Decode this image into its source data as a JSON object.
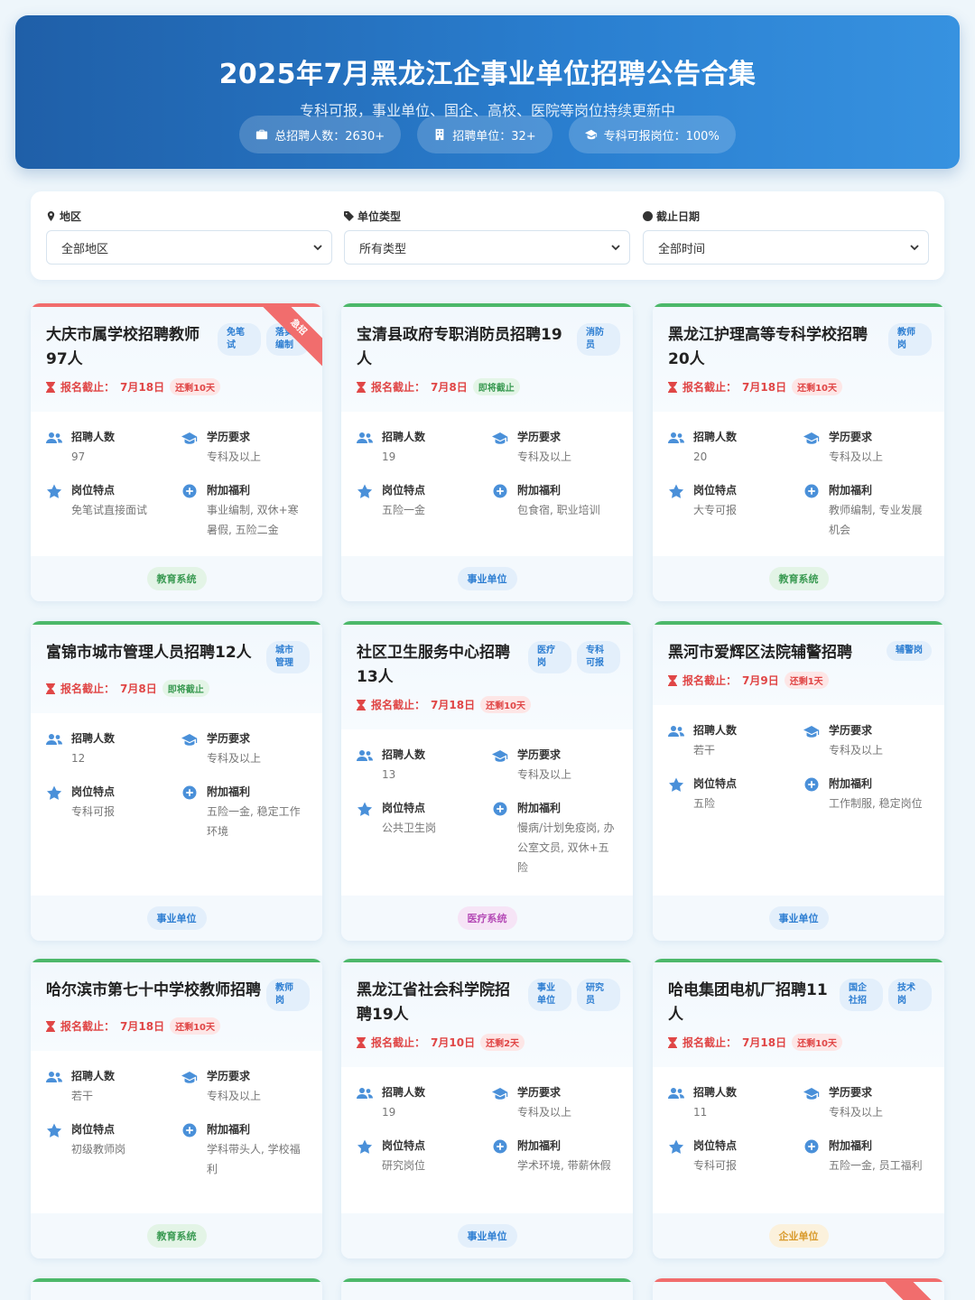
{
  "hero": {
    "title": "2025年7月黑龙江企事业单位招聘公告合集",
    "subtitle": "专科可报，事业单位、国企、高校、医院等岗位持续更新中",
    "stats": [
      "总招聘人数：2630+",
      "招聘单位：32+",
      "专科可报岗位：100%"
    ]
  },
  "filters": [
    {
      "label": "地区",
      "value": "全部地区",
      "icon": "map-marker-icon"
    },
    {
      "label": "单位类型",
      "value": "所有类型",
      "icon": "tag-icon"
    },
    {
      "label": "截止日期",
      "value": "全部时间",
      "icon": "clock-icon"
    }
  ],
  "labels": {
    "deadline_prefix": "报名截止：",
    "count": "招聘人数",
    "edu": "学历要求",
    "feature": "岗位特点",
    "benefit": "附加福利"
  },
  "urgent_ribbon": "急招",
  "cards": [
    {
      "title": "大庆市属学校招聘教师97人",
      "tags": [
        "免笔试",
        "落实编制"
      ],
      "deadline": "7月18日",
      "remain": "还剩10天",
      "count": "97",
      "edu": "专科及以上",
      "feature": "免笔试直接面试",
      "benefit": "事业编制, 双休+寒暑假, 五险二金",
      "category": "教育系统"
    },
    {
      "title": "宝清县政府专职消防员招聘19人",
      "tags": [
        "消防员"
      ],
      "deadline": "7月8日",
      "remain": "即将截止",
      "count": "19",
      "edu": "专科及以上",
      "feature": "五险一金",
      "benefit": "包食宿, 职业培训",
      "category": "事业单位"
    },
    {
      "title": "黑龙江护理高等专科学校招聘20人",
      "tags": [
        "教师岗"
      ],
      "deadline": "7月18日",
      "remain": "还剩10天",
      "count": "20",
      "edu": "专科及以上",
      "feature": "大专可报",
      "benefit": "教师编制, 专业发展机会",
      "category": "教育系统"
    },
    {
      "title": "富锦市城市管理人员招聘12人",
      "tags": [
        "城市管理"
      ],
      "deadline": "7月8日",
      "remain": "即将截止",
      "count": "12",
      "edu": "专科及以上",
      "feature": "专科可报",
      "benefit": "五险一金, 稳定工作环境",
      "category": "事业单位"
    },
    {
      "title": "社区卫生服务中心招聘13人",
      "tags": [
        "医疗岗",
        "专科可报"
      ],
      "deadline": "7月18日",
      "remain": "还剩10天",
      "count": "13",
      "edu": "专科及以上",
      "feature": "公共卫生岗",
      "benefit": "慢病/计划免疫岗, 办公室文员, 双休+五险",
      "category": "医疗系统"
    },
    {
      "title": "黑河市爱辉区法院辅警招聘",
      "tags": [
        "辅警岗"
      ],
      "deadline": "7月9日",
      "remain": "还剩1天",
      "count": "若干",
      "edu": "专科及以上",
      "feature": "五险",
      "benefit": "工作制服, 稳定岗位",
      "category": "事业单位"
    },
    {
      "title": "哈尔滨市第七十中学校教师招聘",
      "tags": [
        "教师岗"
      ],
      "deadline": "7月18日",
      "remain": "还剩10天",
      "count": "若干",
      "edu": "专科及以上",
      "feature": "初级教师岗",
      "benefit": "学科带头人, 学校福利",
      "category": "教育系统"
    },
    {
      "title": "黑龙江省社会科学院招聘19人",
      "tags": [
        "事业单位",
        "研究员"
      ],
      "deadline": "7月10日",
      "remain": "还剩2天",
      "count": "19",
      "edu": "专科及以上",
      "feature": "研究岗位",
      "benefit": "学术环境, 带薪休假",
      "category": "事业单位"
    },
    {
      "title": "哈电集团电机厂招聘11人",
      "tags": [
        "国企社招",
        "技术岗"
      ],
      "deadline": "7月18日",
      "remain": "还剩10天",
      "count": "11",
      "edu": "专科及以上",
      "feature": "专科可报",
      "benefit": "五险一金, 员工福利",
      "category": "企业单位"
    }
  ]
}
